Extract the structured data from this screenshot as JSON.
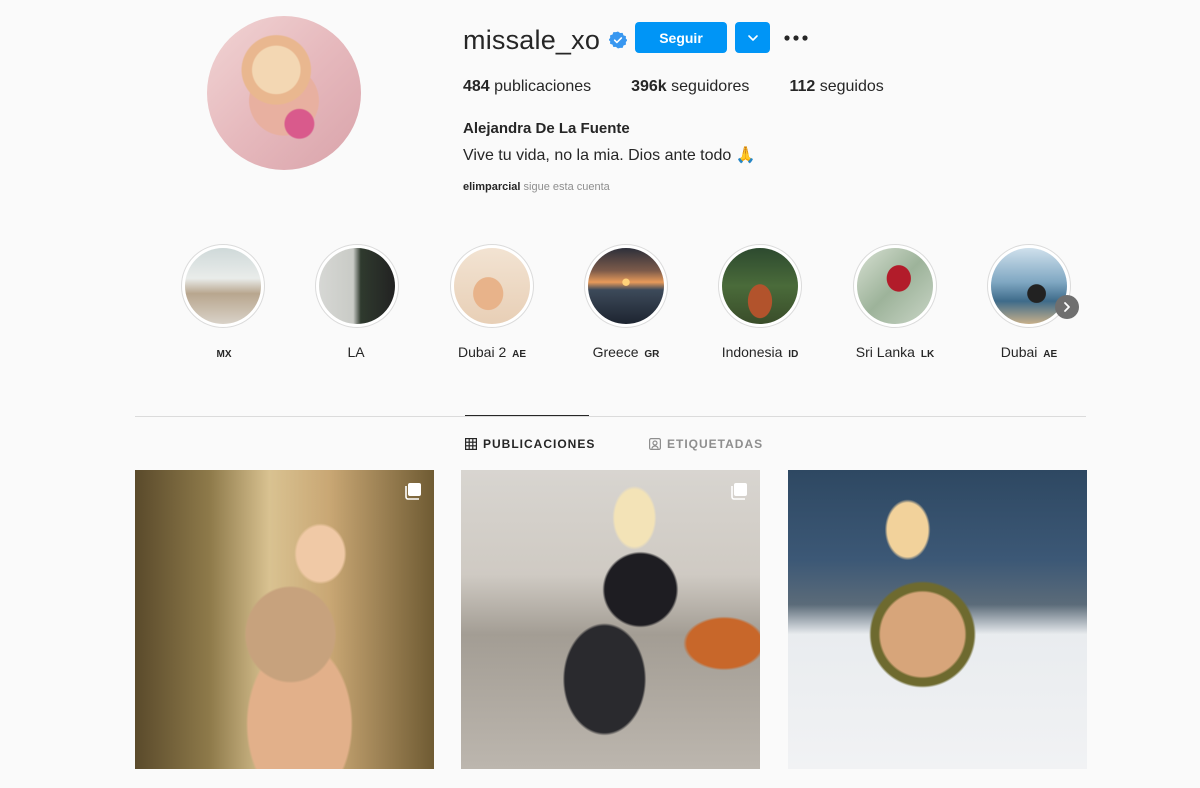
{
  "profile": {
    "username": "missale_xo",
    "verified": true,
    "follow_label": "Seguir",
    "stats": {
      "posts_count": "484",
      "posts_label": "publicaciones",
      "followers_count": "396k",
      "followers_label": "seguidores",
      "following_count": "112",
      "following_label": "seguidos"
    },
    "full_name": "Alejandra De La Fuente",
    "bio": "Vive tu vida, no la mia. Dios ante todo 🙏",
    "followed_by_user": "elimparcial",
    "followed_by_text": "sigue esta cuenta"
  },
  "highlights": [
    {
      "label": "",
      "flag": "MX"
    },
    {
      "label": "LA",
      "flag": ""
    },
    {
      "label": "Dubai 2",
      "flag": "AE"
    },
    {
      "label": "Greece",
      "flag": "GR"
    },
    {
      "label": "Indonesia",
      "flag": "ID"
    },
    {
      "label": "Sri Lanka",
      "flag": "LK"
    },
    {
      "label": "Dubai",
      "flag": "AE"
    }
  ],
  "tabs": {
    "posts": "PUBLICACIONES",
    "tagged": "ETIQUETADAS"
  },
  "colors": {
    "accent": "#0095f6",
    "text": "#262626",
    "muted": "#8e8e8e",
    "background": "#fafafa"
  }
}
